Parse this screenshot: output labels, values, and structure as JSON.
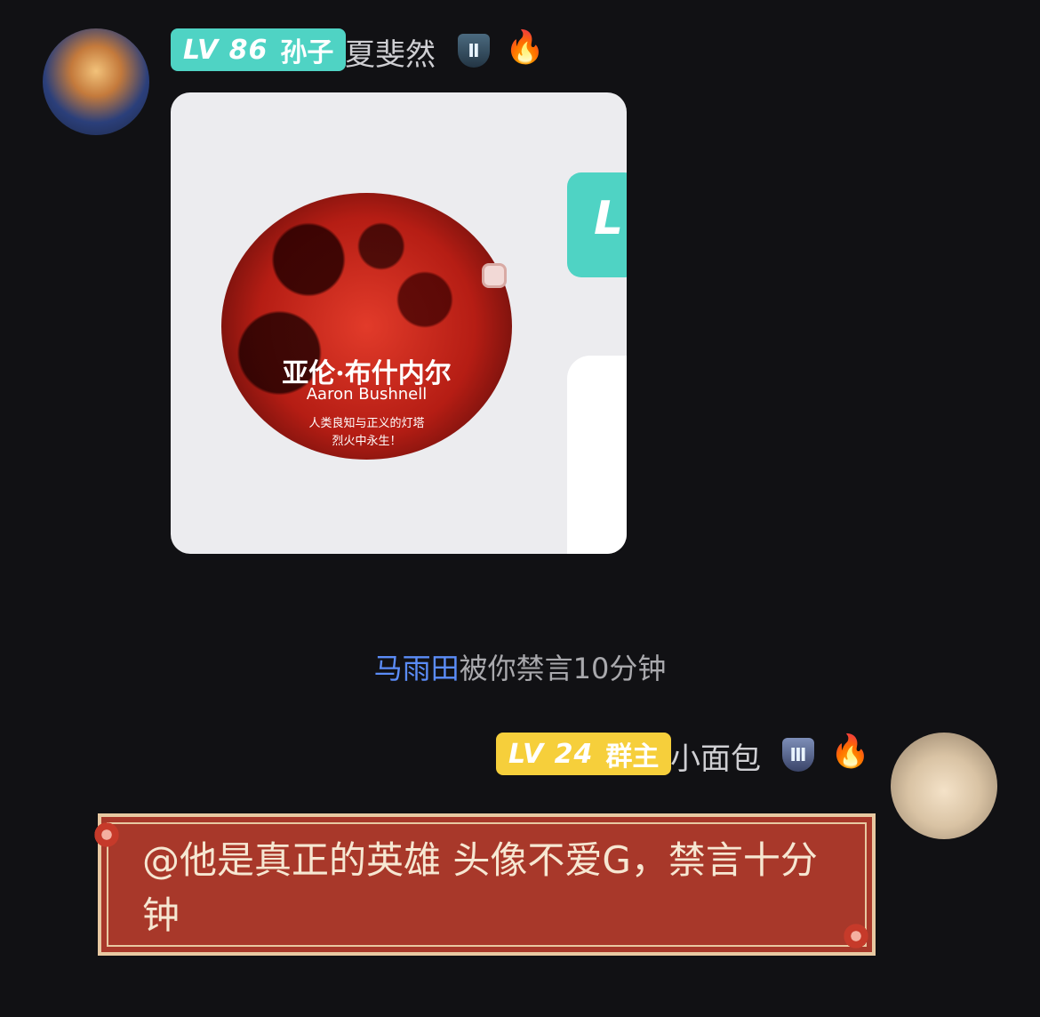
{
  "messages": [
    {
      "sender": {
        "level": "LV 86",
        "title": "孙子",
        "name": "夏斐然",
        "rank_icon": "shield-II-icon",
        "fire_icon": "fire-icon"
      },
      "image": {
        "title": "亚伦·布什内尔",
        "subtitle": "Aaron Bushnell",
        "line1": "人类良知与正义的灯塔",
        "line2": "烈火中永生！",
        "inner_badge": "L"
      }
    }
  ],
  "system_notice": {
    "user": "马雨田",
    "text": "被你禁言10分钟"
  },
  "own_message": {
    "sender": {
      "level": "LV 24",
      "title": "群主",
      "name": "小面包",
      "rank_icon": "shield-III-icon",
      "fire_icon": "fire-icon"
    },
    "text": "@他是真正的英雄 头像不爱G，禁言十分钟"
  },
  "colors": {
    "background": "#111114",
    "badge_level_86": "#4fd3c4",
    "badge_level_24": "#f6cf3b",
    "notice_user": "#5b8cf7",
    "bubble_red": "#a8382a"
  }
}
